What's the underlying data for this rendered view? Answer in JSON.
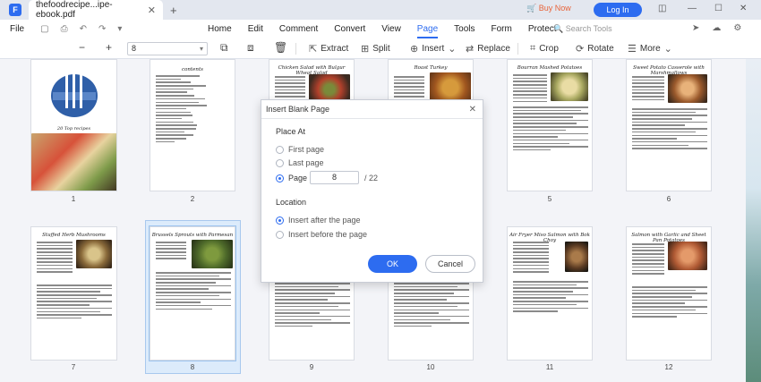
{
  "titlebar": {
    "tab_title": "thefoodrecipe...ipe-ebook.pdf",
    "buy_now": "Buy Now",
    "login": "Log In"
  },
  "menubar": {
    "file": "File",
    "search_placeholder": "Search Tools",
    "items": [
      "Home",
      "Edit",
      "Comment",
      "Convert",
      "View",
      "Page",
      "Tools",
      "Form",
      "Protect"
    ],
    "active": "Page"
  },
  "toolbar": {
    "page_value": "8",
    "extract": "Extract",
    "split": "Split",
    "insert": "Insert",
    "replace": "Replace",
    "crop": "Crop",
    "rotate": "Rotate",
    "more": "More"
  },
  "pages": [
    {
      "num": "1",
      "title": "20 Top recipes"
    },
    {
      "num": "2",
      "title": "contents"
    },
    {
      "num": "3",
      "title": "Chicken Salad with Bulgur Wheat Salad"
    },
    {
      "num": "4",
      "title": "Roast Turkey"
    },
    {
      "num": "5",
      "title": "Bourran Mashed Potatoes"
    },
    {
      "num": "6",
      "title": "Sweet Potato Casserole with Marshmallows"
    },
    {
      "num": "7",
      "title": "Stuffed Herb Mushrooms"
    },
    {
      "num": "8",
      "title": "Brussels Sprouts with Parmesan"
    },
    {
      "num": "9",
      "title": ""
    },
    {
      "num": "10",
      "title": ""
    },
    {
      "num": "11",
      "title": "Air Fryer Miso Salmon with Bok Choy"
    },
    {
      "num": "12",
      "title": "Salmon with Garlic and Sheet Pan Potatoes"
    }
  ],
  "contents_list": [
    "1 Chicken Chicken with Bulgur Wheat Salad",
    "2 Roast Turkey",
    "3 Bourran Mashed Potatoes",
    "4 Sweet Potato Casserole with Marshmallows",
    "5 Stuffed Herb Mushrooms",
    "6 Brussels Sprouts with Parmesan",
    "7 Air Fryer Salmon with Bok Choy",
    "8 Chicken and Arugula with Hot Buttery Honey Sauce",
    "9 Air Fryer Miso Salmon with Bok Choy",
    "10 Salmon with Garlic and Sheet Pan Potatoes",
    "11 Pancakes, Fried Shrimp",
    "12 Chicken Stuffed Shells",
    "13 Cheese Stuffed Shells",
    "14 Best French Toast",
    "15 Tiggy Banana Cheesecake",
    "16 Sausage Breakfast Casserole",
    "17 Sausage Breakfast Cups",
    "18 Nutella Pie Cups",
    "19 Italian Wedding Risotto",
    "20 Pumpkin Pecan Pie",
    "21 Apple Pie"
  ],
  "dialog": {
    "title": "Insert Blank Page",
    "place_at": "Place At",
    "first_page": "First page",
    "last_page": "Last page",
    "page": "Page",
    "page_value": "8",
    "total": "/  22",
    "location": "Location",
    "after": "Insert after the page",
    "before": "Insert before the page",
    "ok": "OK",
    "cancel": "Cancel"
  },
  "colors": {
    "accent": "#2d6cf0",
    "buy_now": "#e8643a"
  }
}
